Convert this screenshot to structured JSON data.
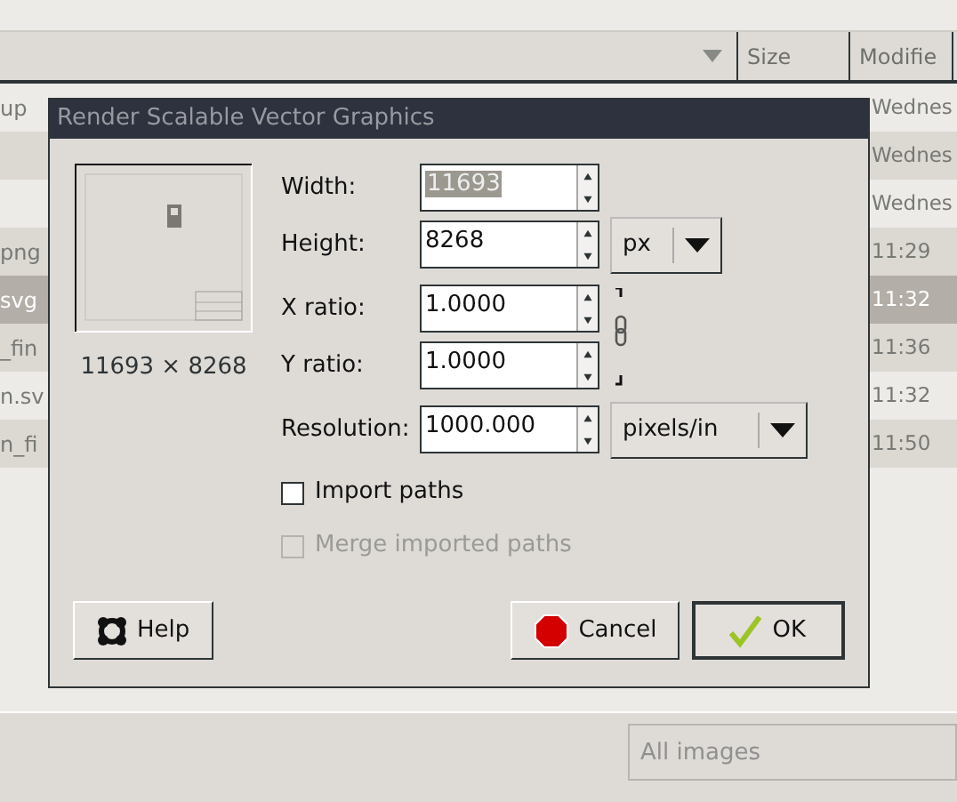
{
  "file_list": {
    "columns": [
      {
        "label": "Size"
      },
      {
        "label": "Modifie"
      }
    ],
    "rows": [
      {
        "name": "up",
        "modified": "Wednes",
        "selected": false
      },
      {
        "modified": "Wednes",
        "selected": false
      },
      {
        "modified": "Wednes",
        "selected": false
      },
      {
        "name": "png",
        "modified": "11:29",
        "selected": false
      },
      {
        "name": "svg",
        "modified": "11:32",
        "selected": true
      },
      {
        "name": "_fin",
        "modified": "11:36",
        "selected": false
      },
      {
        "name": "n.sv",
        "modified": "11:32",
        "selected": false
      },
      {
        "name": "n_fi",
        "modified": "11:50",
        "selected": false
      }
    ],
    "filter": "All images"
  },
  "dialog": {
    "title": "Render Scalable Vector Graphics",
    "preview_caption": "11693 × 8268",
    "fields": [
      {
        "label": "Width:",
        "value": "11693",
        "highlighted": true
      },
      {
        "label": "Height:",
        "value": "8268",
        "highlighted": false,
        "unit": "px"
      },
      {
        "label": "X ratio:",
        "value": "1.0000",
        "highlighted": false
      },
      {
        "label": "Y ratio:",
        "value": "1.0000",
        "highlighted": false
      },
      {
        "label": "Resolution:",
        "value": "1000.000",
        "highlighted": false,
        "unit": "pixels/in"
      }
    ],
    "ratio_linked": true,
    "checkboxes": [
      {
        "label": "Import paths",
        "checked": false,
        "disabled": false
      },
      {
        "label": "Merge imported paths",
        "checked": false,
        "disabled": true
      }
    ],
    "buttons": [
      {
        "label": "Help",
        "kind": "help",
        "default": false
      },
      {
        "label": "Cancel",
        "kind": "cancel",
        "default": false
      },
      {
        "label": "OK",
        "kind": "ok",
        "default": true
      }
    ]
  }
}
